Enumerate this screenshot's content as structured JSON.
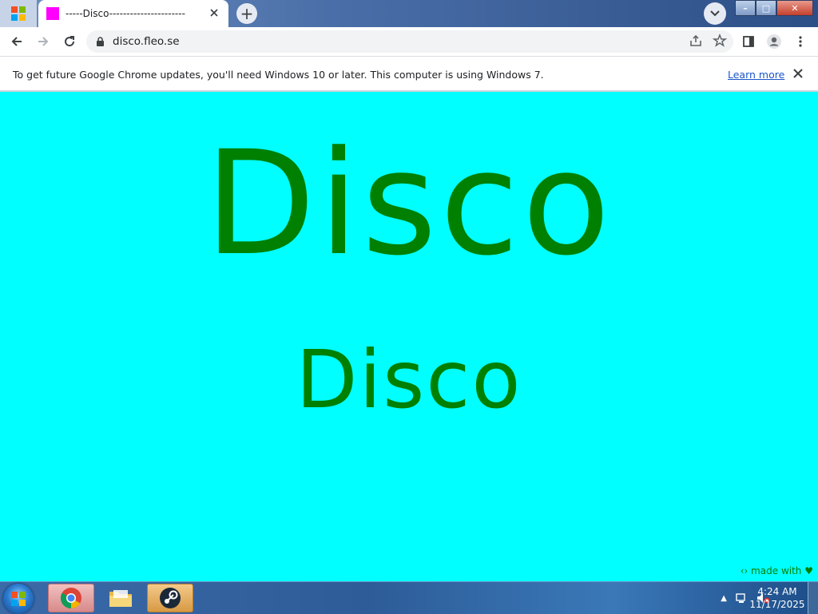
{
  "browser": {
    "tab": {
      "title": "-----Disco----------------------",
      "favicon_color": "#ff00ff"
    },
    "new_tab_symbol": "+",
    "url": "disco.fleo.se",
    "window_controls": {
      "minimize": "–",
      "maximize": "□",
      "close": "✕"
    }
  },
  "infobar": {
    "message": "To get future Google Chrome updates, you'll need Windows 10 or later. This computer is using Windows 7.",
    "learn_more": "Learn more"
  },
  "page": {
    "heading": "Disco",
    "subheading": "Disco",
    "footer": "‹› made with ♥",
    "background": "#00ffff",
    "text_color": "#008000"
  },
  "taskbar": {
    "time": "4:24 AM",
    "date": "11/17/2025"
  }
}
